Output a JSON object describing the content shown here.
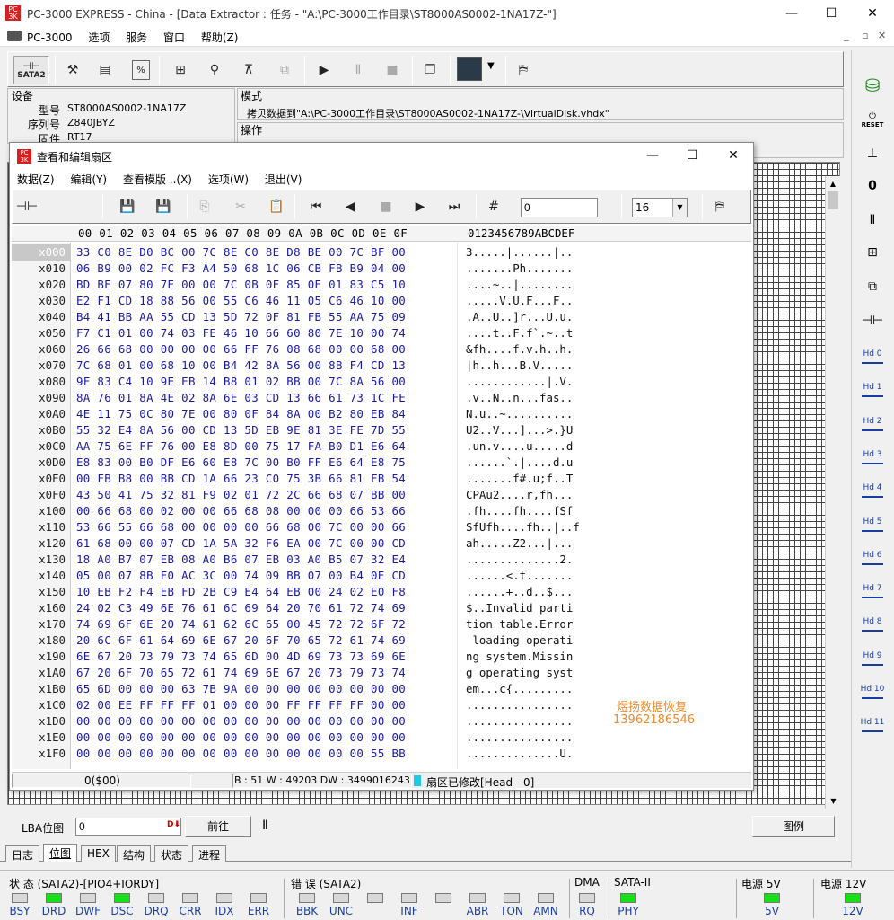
{
  "title": "PC-3000 EXPRESS - China - [Data Extractor : 任务 - \"A:\\PC-3000工作目录\\ST8000AS0002-1NA17Z-\"]",
  "menubar": [
    "PC-3000",
    "选项",
    "服务",
    "窗口",
    "帮助(Z)"
  ],
  "toolbar": {
    "sata_label": "SATA2"
  },
  "device": {
    "group_label": "设备",
    "model_label": "型号",
    "model": "ST8000AS0002-1NA17Z",
    "serial_label": "序列号",
    "serial": "Z840JBYZ",
    "firmware_label": "固件",
    "firmware": "RT17"
  },
  "mode": {
    "group_label": "模式",
    "text": "拷贝数据到\"A:\\PC-3000工作目录\\ST8000AS0002-1NA17Z-\\VirtualDisk.vhdx\""
  },
  "operation": {
    "group_label": "操作"
  },
  "editor": {
    "title": "查看和编辑扇区",
    "menu": [
      "数据(Z)",
      "编辑(Y)",
      "查看模版 ..(X)",
      "选项(W)",
      "退出(V)"
    ],
    "offset_value": "0",
    "columns_value": "16",
    "header_bytes": "00 01 02 03 04 05 06 07 08 09 0A 0B 0C 0D 0E 0F",
    "header_ascii": "0123456789ABCDEF",
    "rows": [
      {
        "off": "x000",
        "hex": "33 C0 8E D0 BC 00 7C 8E C0 8E D8 BE 00 7C BF 00",
        "asc": "3.....|......|.."
      },
      {
        "off": "x010",
        "hex": "06 B9 00 02 FC F3 A4 50 68 1C 06 CB FB B9 04 00",
        "asc": ".......Ph......."
      },
      {
        "off": "x020",
        "hex": "BD BE 07 80 7E 00 00 7C 0B 0F 85 0E 01 83 C5 10",
        "asc": "....~..|........"
      },
      {
        "off": "x030",
        "hex": "E2 F1 CD 18 88 56 00 55 C6 46 11 05 C6 46 10 00",
        "asc": ".....V.U.F...F.."
      },
      {
        "off": "x040",
        "hex": "B4 41 BB AA 55 CD 13 5D 72 0F 81 FB 55 AA 75 09",
        "asc": ".A..U..]r...U.u."
      },
      {
        "off": "x050",
        "hex": "F7 C1 01 00 74 03 FE 46 10 66 60 80 7E 10 00 74",
        "asc": "....t..F.f`.~..t"
      },
      {
        "off": "x060",
        "hex": "26 66 68 00 00 00 00 66 FF 76 08 68 00 00 68 00",
        "asc": "&fh....f.v.h..h."
      },
      {
        "off": "x070",
        "hex": "7C 68 01 00 68 10 00 B4 42 8A 56 00 8B F4 CD 13",
        "asc": "|h..h...B.V....."
      },
      {
        "off": "x080",
        "hex": "9F 83 C4 10 9E EB 14 B8 01 02 BB 00 7C 8A 56 00",
        "asc": "............|.V."
      },
      {
        "off": "x090",
        "hex": "8A 76 01 8A 4E 02 8A 6E 03 CD 13 66 61 73 1C FE",
        "asc": ".v..N..n...fas.."
      },
      {
        "off": "x0A0",
        "hex": "4E 11 75 0C 80 7E 00 80 0F 84 8A 00 B2 80 EB 84",
        "asc": "N.u..~.........."
      },
      {
        "off": "x0B0",
        "hex": "55 32 E4 8A 56 00 CD 13 5D EB 9E 81 3E FE 7D 55",
        "asc": "U2..V...]...>.}U"
      },
      {
        "off": "x0C0",
        "hex": "AA 75 6E FF 76 00 E8 8D 00 75 17 FA B0 D1 E6 64",
        "asc": ".un.v....u.....d"
      },
      {
        "off": "x0D0",
        "hex": "E8 83 00 B0 DF E6 60 E8 7C 00 B0 FF E6 64 E8 75",
        "asc": "......`.|....d.u"
      },
      {
        "off": "x0E0",
        "hex": "00 FB B8 00 BB CD 1A 66 23 C0 75 3B 66 81 FB 54",
        "asc": ".......f#.u;f..T"
      },
      {
        "off": "x0F0",
        "hex": "43 50 41 75 32 81 F9 02 01 72 2C 66 68 07 BB 00",
        "asc": "CPAu2....r,fh..."
      },
      {
        "off": "x100",
        "hex": "00 66 68 00 02 00 00 66 68 08 00 00 00 66 53 66",
        "asc": ".fh....fh....fSf"
      },
      {
        "off": "x110",
        "hex": "53 66 55 66 68 00 00 00 00 66 68 00 7C 00 00 66",
        "asc": "SfUfh....fh..|..f"
      },
      {
        "off": "x120",
        "hex": "61 68 00 00 07 CD 1A 5A 32 F6 EA 00 7C 00 00 CD",
        "asc": "ah.....Z2...|..."
      },
      {
        "off": "x130",
        "hex": "18 A0 B7 07 EB 08 A0 B6 07 EB 03 A0 B5 07 32 E4",
        "asc": "..............2."
      },
      {
        "off": "x140",
        "hex": "05 00 07 8B F0 AC 3C 00 74 09 BB 07 00 B4 0E CD",
        "asc": "......<.t......."
      },
      {
        "off": "x150",
        "hex": "10 EB F2 F4 EB FD 2B C9 E4 64 EB 00 24 02 E0 F8",
        "asc": "......+..d..$..."
      },
      {
        "off": "x160",
        "hex": "24 02 C3 49 6E 76 61 6C 69 64 20 70 61 72 74 69",
        "asc": "$..Invalid parti"
      },
      {
        "off": "x170",
        "hex": "74 69 6F 6E 20 74 61 62 6C 65 00 45 72 72 6F 72",
        "asc": "tion table.Error"
      },
      {
        "off": "x180",
        "hex": "20 6C 6F 61 64 69 6E 67 20 6F 70 65 72 61 74 69",
        "asc": " loading operati"
      },
      {
        "off": "x190",
        "hex": "6E 67 20 73 79 73 74 65 6D 00 4D 69 73 73 69 6E",
        "asc": "ng system.Missin"
      },
      {
        "off": "x1A0",
        "hex": "67 20 6F 70 65 72 61 74 69 6E 67 20 73 79 73 74",
        "asc": "g operating syst"
      },
      {
        "off": "x1B0",
        "hex": "65 6D 00 00 00 63 7B 9A 00 00 00 00 00 00 00 00",
        "asc": "em...c{........."
      },
      {
        "off": "x1C0",
        "hex": "02 00 EE FF FF FF 01 00 00 00 FF FF FF FF 00 00",
        "asc": "................"
      },
      {
        "off": "x1D0",
        "hex": "00 00 00 00 00 00 00 00 00 00 00 00 00 00 00 00",
        "asc": "................"
      },
      {
        "off": "x1E0",
        "hex": "00 00 00 00 00 00 00 00 00 00 00 00 00 00 00 00",
        "asc": "................"
      },
      {
        "off": "x1F0",
        "hex": "00 00 00 00 00 00 00 00 00 00 00 00 00 00 55 BB",
        "asc": "..............U."
      }
    ],
    "watermark_name": "煜扬数据恢复",
    "watermark_phone": "13962186546",
    "status_offset": "0($00)",
    "status_info": "B : 51 W : 49203 DW : 3499016243",
    "status_modified": "扇区已修改[Head - 0]"
  },
  "lba": {
    "label": "LBA位图",
    "value": "0",
    "goto_label": "前往",
    "legend_label": "图例"
  },
  "tabs": [
    "日志",
    "位图",
    "HEX",
    "结构",
    "状态",
    "进程"
  ],
  "status_panel": {
    "state_title": "状 态 (SATA2)-[PIO4+IORDY]",
    "error_title": "错 误 (SATA2)",
    "dma_title": "DMA",
    "sata_title": "SATA-II",
    "power5_title": "电源 5V",
    "power12_title": "电源 12V",
    "leds": [
      {
        "label": "BSY",
        "on": false
      },
      {
        "label": "DRD",
        "on": true
      },
      {
        "label": "DWF",
        "on": false
      },
      {
        "label": "DSC",
        "on": true
      },
      {
        "label": "DRQ",
        "on": false
      },
      {
        "label": "CRR",
        "on": false
      },
      {
        "label": "IDX",
        "on": false
      },
      {
        "label": "ERR",
        "on": false
      }
    ],
    "err_leds": [
      {
        "label": "BBK",
        "on": false
      },
      {
        "label": "UNC",
        "on": false
      },
      {
        "label": "",
        "on": false
      },
      {
        "label": "INF",
        "on": false
      },
      {
        "label": "",
        "on": false
      },
      {
        "label": "ABR",
        "on": false
      },
      {
        "label": "TON",
        "on": false
      },
      {
        "label": "AMN",
        "on": false
      }
    ],
    "dma_label": "RQ",
    "phy_label": "PHY",
    "v5_label": "5V",
    "v12_label": "12V"
  },
  "right_toolbar": {
    "reset_label": "RESET",
    "hd_labels": [
      "Hd 0",
      "Hd 1",
      "Hd 2",
      "Hd 3",
      "Hd 4",
      "Hd 5",
      "Hd 6",
      "Hd 7",
      "Hd 8",
      "Hd 9",
      "Hd 10",
      "Hd 11"
    ]
  }
}
